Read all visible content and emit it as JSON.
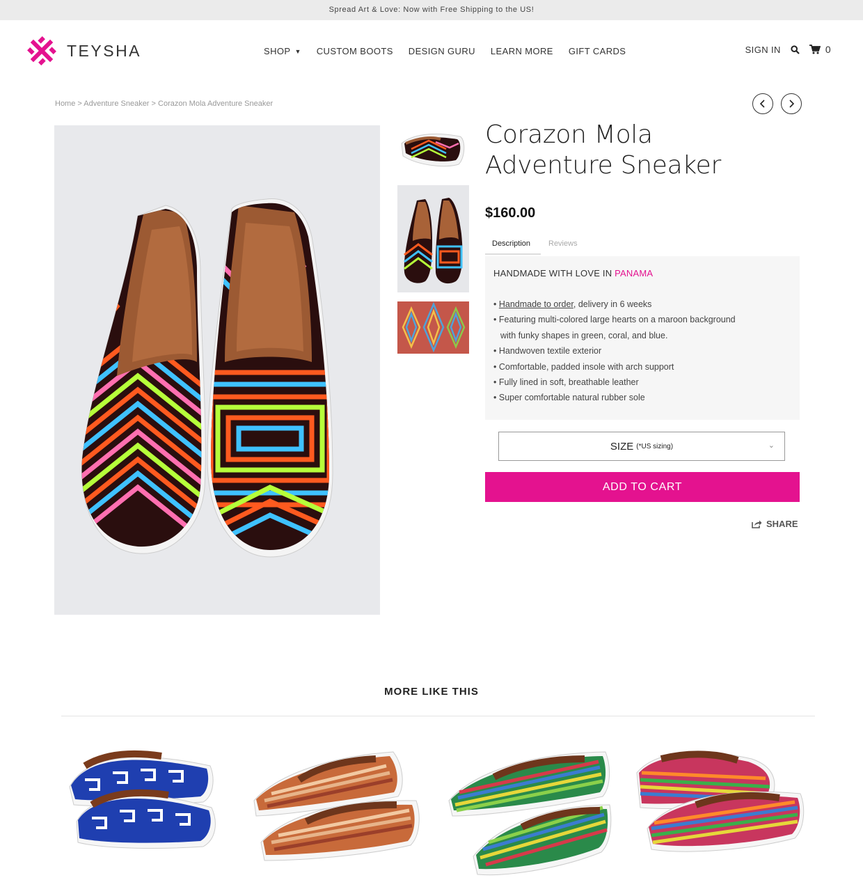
{
  "announcement": "Spread Art & Love: Now with Free Shipping to the US!",
  "brand": {
    "name": "TEYSHA",
    "accent_color": "#e4128f"
  },
  "nav": {
    "items": [
      "SHOP",
      "CUSTOM BOOTS",
      "DESIGN GURU",
      "LEARN MORE",
      "GIFT CARDS"
    ],
    "shop_icon": "chevron-down-icon"
  },
  "account": {
    "sign_in": "SIGN IN",
    "cart_count": "0",
    "search_icon": "search-icon",
    "cart_icon": "cart-icon"
  },
  "breadcrumb": [
    "Home",
    "Adventure Sneaker",
    "Corazon Mola Adventure Sneaker"
  ],
  "breadcrumb_separator": ">",
  "pager": {
    "prev_icon": "chevron-left-icon",
    "next_icon": "chevron-right-icon"
  },
  "product": {
    "title_line1": "Corazon Mola",
    "title_line2": "Adventure Sneaker",
    "price": "$160.00",
    "tabs": [
      "Description",
      "Reviews"
    ],
    "active_tab": "Description",
    "desc_heading": "HANDMADE WITH LOVE IN ",
    "desc_heading_highlight": "PANAMA",
    "bullets": [
      {
        "link": "Handmade to order",
        "text": ", delivery in 6 weeks"
      },
      {
        "text": "Featuring multi-colored large hearts on a maroon background"
      },
      {
        "text": "with funky shapes in green, coral, and blue.",
        "indent": true
      },
      {
        "text": "Handwoven textile exterior"
      },
      {
        "text": "Comfortable, padded insole with arch support"
      },
      {
        "text": "Fully lined in soft, breathable leather"
      },
      {
        "text": "Super comfortable natural rubber sole"
      }
    ],
    "size_label": "SIZE",
    "size_note": "(*US sizing)",
    "add_to_cart": "ADD TO CART",
    "share": "SHARE"
  },
  "related": {
    "title": "MORE LIKE THIS"
  }
}
